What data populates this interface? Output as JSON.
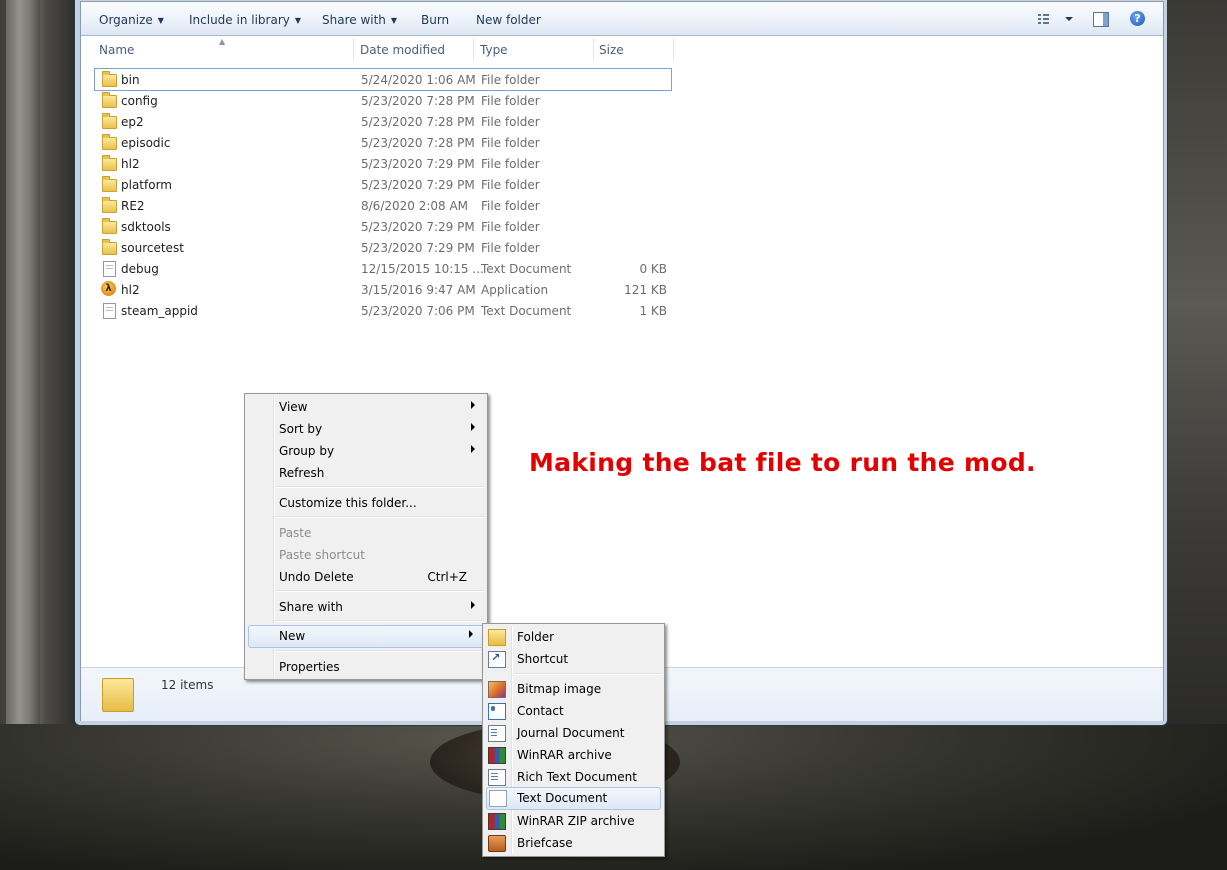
{
  "toolbar": {
    "organize": "Organize",
    "include_in_library": "Include in library",
    "share_with": "Share with",
    "burn": "Burn",
    "new_folder": "New folder",
    "help": "?"
  },
  "columns": {
    "name": "Name",
    "date_modified": "Date modified",
    "type": "Type",
    "size": "Size"
  },
  "files": [
    {
      "name": "bin",
      "date": "5/24/2020 1:06 AM",
      "type": "File folder",
      "size": "",
      "icon": "folder-icon"
    },
    {
      "name": "config",
      "date": "5/23/2020 7:28 PM",
      "type": "File folder",
      "size": "",
      "icon": "folder-icon"
    },
    {
      "name": "ep2",
      "date": "5/23/2020 7:28 PM",
      "type": "File folder",
      "size": "",
      "icon": "folder-icon"
    },
    {
      "name": "episodic",
      "date": "5/23/2020 7:28 PM",
      "type": "File folder",
      "size": "",
      "icon": "folder-icon"
    },
    {
      "name": "hl2",
      "date": "5/23/2020 7:29 PM",
      "type": "File folder",
      "size": "",
      "icon": "folder-icon"
    },
    {
      "name": "platform",
      "date": "5/23/2020 7:29 PM",
      "type": "File folder",
      "size": "",
      "icon": "folder-icon"
    },
    {
      "name": "RE2",
      "date": "8/6/2020 2:08 AM",
      "type": "File folder",
      "size": "",
      "icon": "folder-icon"
    },
    {
      "name": "sdktools",
      "date": "5/23/2020 7:29 PM",
      "type": "File folder",
      "size": "",
      "icon": "folder-icon"
    },
    {
      "name": "sourcetest",
      "date": "5/23/2020 7:29 PM",
      "type": "File folder",
      "size": "",
      "icon": "folder-icon"
    },
    {
      "name": "debug",
      "date": "12/15/2015 10:15 ...",
      "type": "Text Document",
      "size": "0 KB",
      "icon": "text-document-icon"
    },
    {
      "name": "hl2",
      "date": "3/15/2016 9:47 AM",
      "type": "Application",
      "size": "121 KB",
      "icon": "half-life-app-icon"
    },
    {
      "name": "steam_appid",
      "date": "5/23/2020 7:06 PM",
      "type": "Text Document",
      "size": "1 KB",
      "icon": "text-document-icon"
    }
  ],
  "details": {
    "item_count": "12 items"
  },
  "annotation": "Making the bat file to run the mod.",
  "context_menu": {
    "view": "View",
    "sort_by": "Sort by",
    "group_by": "Group by",
    "refresh": "Refresh",
    "customize": "Customize this folder...",
    "paste": "Paste",
    "paste_shortcut": "Paste shortcut",
    "undo_delete": "Undo Delete",
    "undo_shortcut": "Ctrl+Z",
    "share_with": "Share with",
    "new": "New",
    "properties": "Properties"
  },
  "new_submenu": {
    "folder": "Folder",
    "shortcut": "Shortcut",
    "bitmap": "Bitmap image",
    "contact": "Contact",
    "journal": "Journal Document",
    "winrar_archive": "WinRAR archive",
    "rich_text": "Rich Text Document",
    "text_document": "Text Document",
    "winrar_zip": "WinRAR ZIP archive",
    "briefcase": "Briefcase"
  },
  "colors": {
    "annotation": "#e30000",
    "toolbar_text": "#1e395b",
    "highlight_border": "#a8c4e6"
  }
}
